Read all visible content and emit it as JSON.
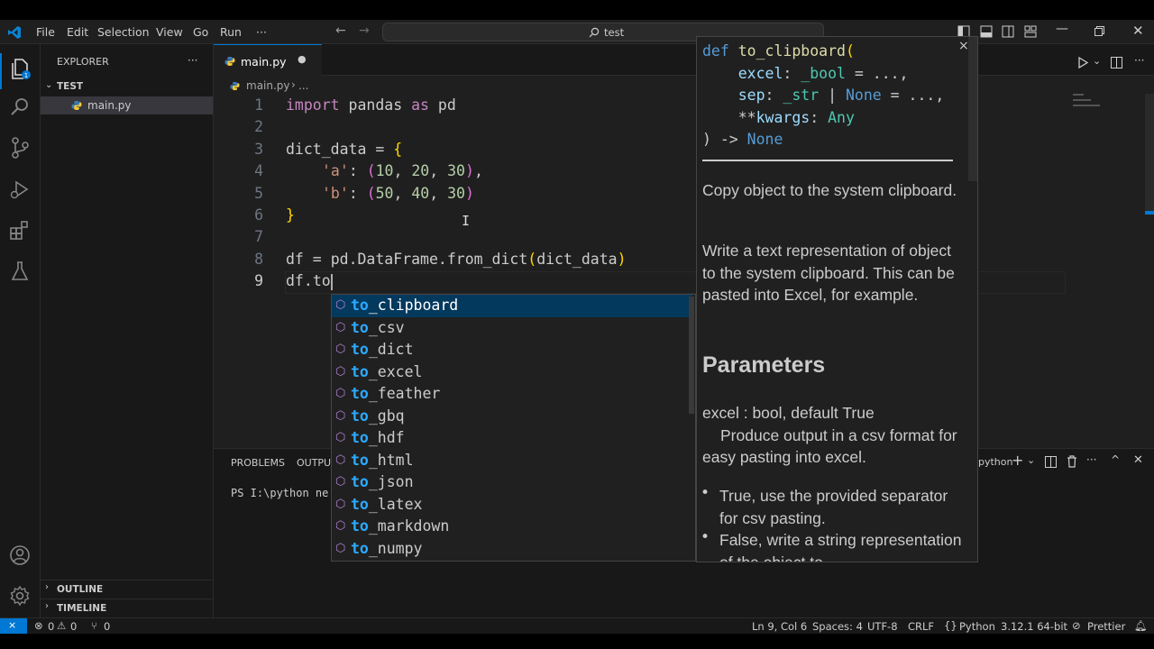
{
  "titlebar": {
    "menus": [
      "File",
      "Edit",
      "Selection",
      "View",
      "Go",
      "Run",
      "···"
    ],
    "search": "test"
  },
  "sidebar": {
    "title": "EXPLORER",
    "more": "···",
    "folder": "TEST",
    "file": "main.py",
    "outline": "OUTLINE",
    "timeline": "TIMELINE"
  },
  "tab": {
    "label": "main.py",
    "dot": "●"
  },
  "breadcrumb": {
    "file": "main.py",
    "sep": "›",
    "rest": "..."
  },
  "code": {
    "lines": [
      {
        "n": "1",
        "text": ""
      },
      {
        "n": "2",
        "text": ""
      },
      {
        "n": "3",
        "text": ""
      },
      {
        "n": "4",
        "text": ""
      },
      {
        "n": "5",
        "text": ""
      },
      {
        "n": "6",
        "text": ""
      },
      {
        "n": "7",
        "text": ""
      },
      {
        "n": "8",
        "text": ""
      },
      {
        "n": "9",
        "text": ""
      }
    ],
    "tokens": {
      "l1_import": "import",
      "l1_pandas": " pandas ",
      "l1_as": "as",
      "l1_pd": " pd",
      "l3_var": "dict_data",
      "l3_eq": " = ",
      "l3_brace": "{",
      "l4_key": "'a'",
      "l4_colon": ": ",
      "l4_p1": "(",
      "l4_v1": "10",
      "l4_c1": ", ",
      "l4_v2": "20",
      "l4_c2": ", ",
      "l4_v3": "30",
      "l4_p2": ")",
      "l4_comma": ",",
      "l5_key": "'b'",
      "l5_colon": ": ",
      "l5_p1": "(",
      "l5_v1": "50",
      "l5_c1": ", ",
      "l5_v2": "40",
      "l5_c2": ", ",
      "l5_v3": "30",
      "l5_p2": ")",
      "l6_brace": "}",
      "l8_df": "df",
      "l8_eq": " = ",
      "l8_pd": "pd",
      "l8_dot1": ".",
      "l8_cls": "DataFrame",
      "l8_dot2": ".",
      "l8_fn": "from_dict",
      "l8_p1": "(",
      "l8_arg": "dict_data",
      "l8_p2": ")",
      "l9_df": "df",
      "l9_dot": ".",
      "l9_to": "to"
    }
  },
  "suggest": {
    "icon": "⬡",
    "items": [
      {
        "bold": "to",
        "rest": "_clipboard"
      },
      {
        "bold": "to",
        "rest": "_csv"
      },
      {
        "bold": "to",
        "rest": "_dict"
      },
      {
        "bold": "to",
        "rest": "_excel"
      },
      {
        "bold": "to",
        "rest": "_feather"
      },
      {
        "bold": "to",
        "rest": "_gbq"
      },
      {
        "bold": "to",
        "rest": "_hdf"
      },
      {
        "bold": "to",
        "rest": "_html"
      },
      {
        "bold": "to",
        "rest": "_json"
      },
      {
        "bold": "to",
        "rest": "_latex"
      },
      {
        "bold": "to",
        "rest": "_markdown"
      },
      {
        "bold": "to",
        "rest": "_numpy"
      }
    ]
  },
  "details": {
    "close": "×",
    "sig": {
      "def": "def",
      "name": " to_clipboard",
      "p": "(",
      "a1": "    excel",
      "a1c": ": ",
      "a1t": "_bool",
      "a1d": " = ...,",
      "a2": "    sep",
      "a2c": ": ",
      "a2t": "_str",
      "a2bar": " | ",
      "a2n": "None",
      "a2d": " = ...,",
      "a3s": "    **",
      "a3": "kwargs",
      "a3c": ": ",
      "a3t": "Any",
      "ret": ") -> ",
      "rett": "None"
    },
    "p1": "Copy object to the system clipboard.",
    "p2": "Write a text representation of object to the system clipboard. This can be pasted into Excel, for example.",
    "h_params": "Parameters",
    "param1": "excel : bool, default True",
    "param1_desc": "Produce output in a csv format for easy pasting into excel.",
    "bullet1": "True, use the provided separator for csv pasting.",
    "bullet2": "False, write a string representation of the object to"
  },
  "panel": {
    "tabs": [
      "PROBLEMS",
      "OUTPUT"
    ],
    "terminal": "PS I:\\python ne",
    "shell": "python"
  },
  "status": {
    "errors": "0",
    "warnings": "0",
    "ports": "0",
    "position": "Ln 9, Col 6",
    "spaces": "Spaces: 4",
    "encoding": "UTF-8",
    "eol": "CRLF",
    "language": "Python",
    "interpreter": "3.12.1 64-bit",
    "prettier": "Prettier"
  },
  "colors": {
    "keyword": "#c586c0",
    "blue": "#569cd6",
    "var": "#9cdcfe",
    "cls": "#4ec9b0",
    "fn": "#dcdcaa",
    "num": "#b5cea8",
    "str": "#ce9178",
    "brace": "#ffd700",
    "paren2": "#da70d6",
    "accent": "#0078d4"
  }
}
